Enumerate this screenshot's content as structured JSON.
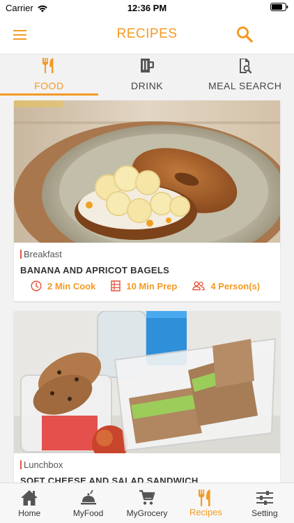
{
  "status_bar": {
    "carrier": "Carrier",
    "time": "12:36 PM"
  },
  "header": {
    "title": "RECIPES",
    "menu_icon": "hamburger-menu-icon",
    "search_icon": "search-icon"
  },
  "tabs": [
    {
      "label": "FOOD",
      "icon": "fork-knife-icon",
      "active": true
    },
    {
      "label": "DRINK",
      "icon": "mug-icon",
      "active": false
    },
    {
      "label": "MEAL SEARCH",
      "icon": "document-search-icon",
      "active": false
    }
  ],
  "recipes": [
    {
      "category": "Breakfast",
      "title": "BANANA AND APRICOT BAGELS",
      "cook": "2 Min Cook",
      "prep": "10 Min Prep",
      "persons": "4 Person(s)"
    },
    {
      "category": "Lunchbox",
      "title": "SOFT CHEESE AND SALAD SANDWICH"
    }
  ],
  "bottom_nav": [
    {
      "label": "Home",
      "icon": "home-icon",
      "active": false
    },
    {
      "label": "MyFood",
      "icon": "serving-dish-icon",
      "active": false
    },
    {
      "label": "MyGrocery",
      "icon": "shopping-cart-icon",
      "active": false
    },
    {
      "label": "Recipes",
      "icon": "fork-knife-icon",
      "active": true
    },
    {
      "label": "Setting",
      "icon": "sliders-icon",
      "active": false
    }
  ],
  "colors": {
    "accent": "#f49a23",
    "category_marker": "#e8573e"
  }
}
